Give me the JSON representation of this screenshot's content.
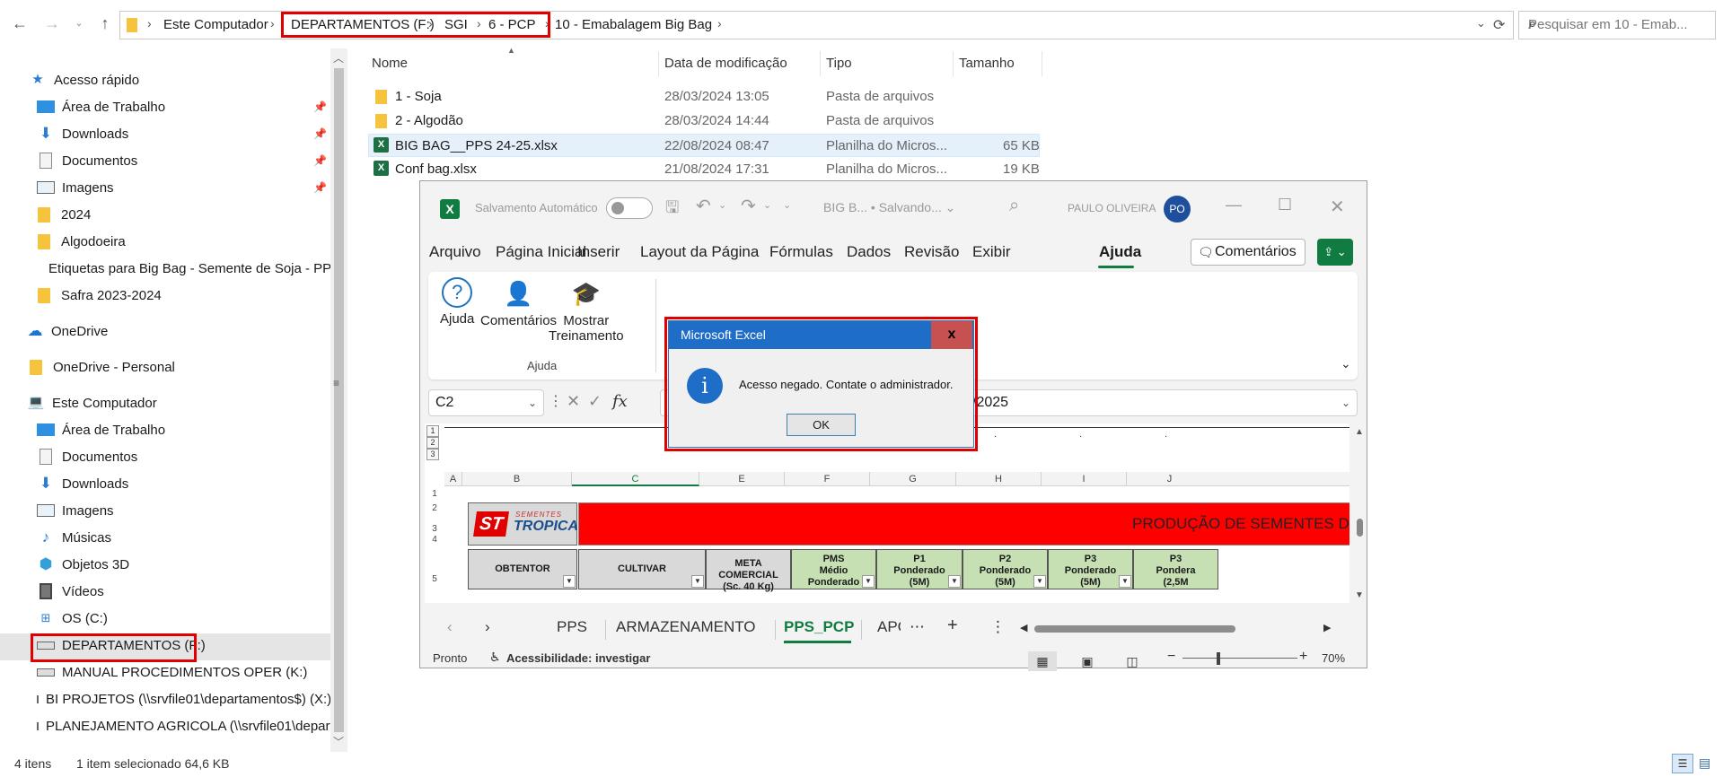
{
  "explorer": {
    "breadcrumbs": [
      "Este Computador",
      "DEPARTAMENTOS (F:)",
      "SGI",
      "6 - PCP",
      "10 - Emabalagem Big Bag"
    ],
    "search_placeholder": "Pesquisar em 10 - Emab...",
    "nav": {
      "quick_access": "Acesso rápido",
      "quick_items": [
        "Área de Trabalho",
        "Downloads",
        "Documentos",
        "Imagens",
        "2024",
        "Algodoeira",
        "Etiquetas para Big Bag - Semente de Soja - PP",
        "Safra 2023-2024"
      ],
      "onedrive": "OneDrive",
      "onedrive_personal": "OneDrive - Personal",
      "this_pc": "Este Computador",
      "pc_items": [
        "Área de Trabalho",
        "Documentos",
        "Downloads",
        "Imagens",
        "Músicas",
        "Objetos 3D",
        "Vídeos",
        "OS (C:)",
        "DEPARTAMENTOS (F:)",
        "MANUAL PROCEDIMENTOS OPER (K:)",
        "BI PROJETOS (\\\\srvfile01\\departamentos$) (X:)",
        "PLANEJAMENTO AGRICOLA (\\\\srvfile01\\departamentos$)"
      ]
    },
    "columns": [
      "Nome",
      "Data de modificação",
      "Tipo",
      "Tamanho"
    ],
    "files": [
      {
        "name": "1 - Soja",
        "date": "28/03/2024 13:05",
        "type": "Pasta de arquivos",
        "size": ""
      },
      {
        "name": "2 - Algodão",
        "date": "28/03/2024 14:44",
        "type": "Pasta de arquivos",
        "size": ""
      },
      {
        "name": "BIG BAG__PPS 24-25.xlsx",
        "date": "22/08/2024 08:47",
        "type": "Planilha do Micros...",
        "size": "65 KB"
      },
      {
        "name": "Conf bag.xlsx",
        "date": "21/08/2024 17:31",
        "type": "Planilha do Micros...",
        "size": "19 KB"
      }
    ],
    "status": {
      "count": "4 itens",
      "selection": "1 item selecionado  64,6 KB"
    }
  },
  "excel": {
    "autosave": "Salvamento Automático",
    "doc_title": "BIG B... • Salvando... ⌄",
    "user": "PAULO OLIVEIRA",
    "user_initials": "PO",
    "menu": [
      "Arquivo",
      "Página Inicial",
      "Inserir",
      "Layout da Página",
      "Fórmulas",
      "Dados",
      "Revisão",
      "Exibir",
      "Ajuda"
    ],
    "comments_btn": "Comentários",
    "ribbon": {
      "help": "Ajuda",
      "comments": "Comentários",
      "training_1": "Mostrar",
      "training_2": "Treinamento",
      "group": "Ajuda"
    },
    "namebox": "C2",
    "formula_value": "/2025",
    "columns": [
      "A",
      "B",
      "C",
      "E",
      "F",
      "G",
      "H",
      "I",
      "J"
    ],
    "rows": [
      "1",
      "2",
      "3",
      "4",
      "5"
    ],
    "brand_small": "SEMENTES",
    "brand_name": "TROPICAL",
    "brand_logo": "ST",
    "sheet_title": "PRODUÇÃO DE SEMENTES DE SOJ",
    "header_cells": [
      {
        "line1": "OBTENTOR",
        "line2": "",
        "line3": ""
      },
      {
        "line1": "CULTIVAR",
        "line2": "",
        "line3": ""
      },
      {
        "line1": "META COMERCIAL",
        "line2": "(Sc. 40 Kg)",
        "line3": ""
      },
      {
        "line1": "PMS",
        "line2": "Médio",
        "line3": "Ponderado"
      },
      {
        "line1": "P1",
        "line2": "Ponderado",
        "line3": "(5M)"
      },
      {
        "line1": "P2",
        "line2": "Ponderado",
        "line3": "(5M)"
      },
      {
        "line1": "P3",
        "line2": "Ponderado",
        "line3": "(5M)"
      },
      {
        "line1": "P3",
        "line2": "Pondera",
        "line3": "(2,5M"
      }
    ],
    "tabs": [
      "PPS",
      "ARMAZENAMENTO",
      "PPS_PCP",
      "APC"
    ],
    "status_ready": "Pronto",
    "accessibility": "Acessibilidade: investigar",
    "zoom": "70%"
  },
  "dialog": {
    "title": "Microsoft Excel",
    "message": "Acesso negado. Contate o administrador.",
    "ok": "OK",
    "close": "x"
  },
  "colors": {
    "highlight": "#e00000",
    "excel_green": "#107c41",
    "dialog_blue": "#1e6ec8",
    "title_red": "#ff0000"
  }
}
